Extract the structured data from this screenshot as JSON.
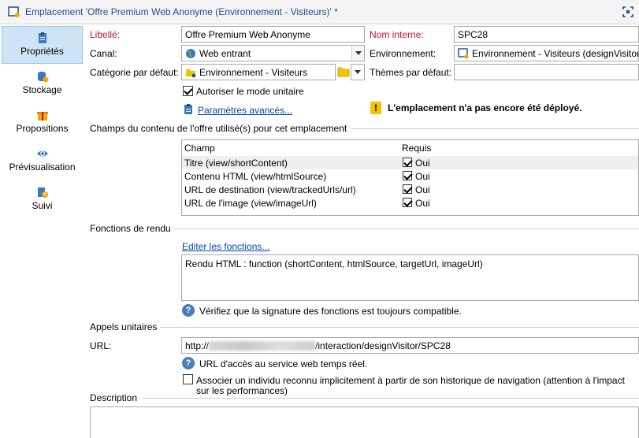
{
  "window": {
    "title": "Emplacement 'Offre Premium Web Anonyme (Environnement - Visiteurs)' *"
  },
  "sidebar": {
    "items": [
      {
        "label": "Propriétés",
        "icon": "clipboard-icon",
        "active": true
      },
      {
        "label": "Stockage",
        "icon": "database-sync-icon",
        "active": false
      },
      {
        "label": "Propositions",
        "icon": "gift-icon",
        "active": false
      },
      {
        "label": "Prévisualisation",
        "icon": "eye-icon",
        "active": false
      },
      {
        "label": "Suivi",
        "icon": "tracking-icon",
        "active": false
      }
    ]
  },
  "form": {
    "libelle_label": "Libellé:",
    "libelle_value": "Offre Premium Web Anonyme",
    "nom_interne_label": "Nom interne:",
    "nom_interne_value": "SPC28",
    "canal_label": "Canal:",
    "canal_value": "Web entrant",
    "environnement_label": "Environnement:",
    "environnement_value": "Environnement - Visiteurs (designVisitor)",
    "categorie_label": "Catégorie par défaut:",
    "categorie_value": "Environnement - Visiteurs",
    "themes_label": "Thèmes par défaut:",
    "themes_value": "",
    "mode_unitaire_label": "Autoriser le mode unitaire",
    "mode_unitaire_checked": true,
    "params_avances_link": "Paramètres avancés...",
    "warning_text": "L'emplacement n'a pas encore été déployé."
  },
  "champs_section": {
    "title": "Champs du contenu de l'offre utilisé(s) pour cet emplacement",
    "columns": [
      "Champ",
      "Requis"
    ],
    "rows": [
      {
        "champ": "Titre (view/shortContent)",
        "requis": "Oui",
        "checked": true
      },
      {
        "champ": "Contenu HTML (view/htmlSource)",
        "requis": "Oui",
        "checked": true
      },
      {
        "champ": "URL de destination (view/trackedUrls/url)",
        "requis": "Oui",
        "checked": true
      },
      {
        "champ": "URL de l'image (view/imageUrl)",
        "requis": "Oui",
        "checked": true
      }
    ]
  },
  "rendu_section": {
    "title": "Fonctions de rendu",
    "edit_link": "Editer les fonctions...",
    "function_text": "Rendu HTML : function (shortContent, htmlSource, targetUrl, imageUrl)",
    "help_text": "Vérifiez que la signature des fonctions est toujours compatible."
  },
  "appels_section": {
    "title": "Appels unitaires",
    "url_label": "URL:",
    "url_prefix": "http://",
    "url_suffix": "/interaction/designVisitor/SPC28",
    "help_text": "URL d'accès au service web temps réel.",
    "associate_line1": "Associer un individu reconnu implicitement à partir de son historique de navigation (attention à l'impact",
    "associate_line2": "sur les performances)",
    "associate_checked": false
  },
  "description_section": {
    "title": "Description",
    "value": ""
  },
  "colors": {
    "accent": "#1f4e8c",
    "required_label": "#c8102e",
    "link": "#0645ad",
    "active_nav": "#cde4f7",
    "warning": "#f2c300"
  }
}
